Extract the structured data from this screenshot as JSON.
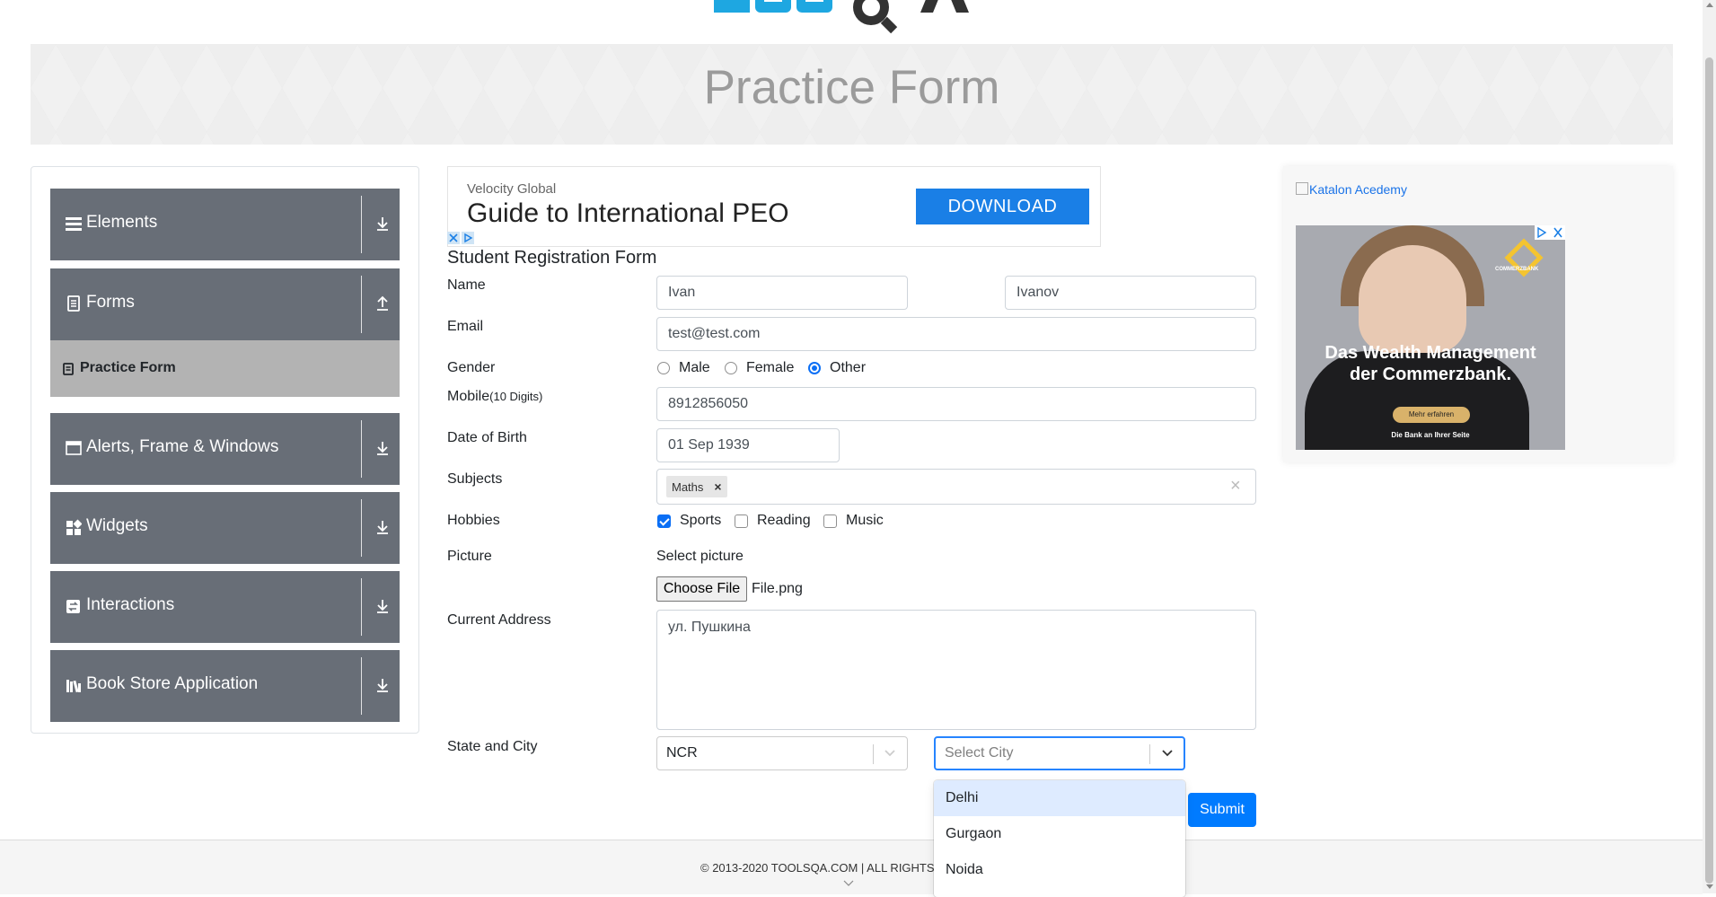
{
  "header": {
    "title": "Practice Form"
  },
  "sidebar": {
    "groups": [
      {
        "label": "Elements",
        "icon": "list-icon"
      },
      {
        "label": "Forms",
        "icon": "document-icon"
      },
      {
        "label": "Alerts, Frame & Windows",
        "icon": "window-icon"
      },
      {
        "label": "Widgets",
        "icon": "widgets-icon"
      },
      {
        "label": "Interactions",
        "icon": "interactions-icon"
      },
      {
        "label": "Book Store Application",
        "icon": "books-icon"
      }
    ],
    "active_item": {
      "label": "Practice Form",
      "icon": "form-icon"
    }
  },
  "ad_top": {
    "advertiser": "Velocity Global",
    "headline": "Guide to International PEO",
    "button": "DOWNLOAD"
  },
  "form": {
    "title": "Student Registration Form",
    "name_label": "Name",
    "first_name": "Ivan",
    "last_name": "Ivanov",
    "email_label": "Email",
    "email": "test@test.com",
    "gender_label": "Gender",
    "gender_options": [
      "Male",
      "Female",
      "Other"
    ],
    "gender_selected": "Other",
    "mobile_label": "Mobile",
    "mobile_hint": "(10 Digits)",
    "mobile": "8912856050",
    "dob_label": "Date of Birth",
    "dob": "01 Sep 1939",
    "subjects_label": "Subjects",
    "subjects": [
      "Maths"
    ],
    "subject_remove": "×",
    "subjects_clear": "×",
    "hobbies_label": "Hobbies",
    "hobbies": [
      {
        "label": "Sports",
        "checked": true
      },
      {
        "label": "Reading",
        "checked": false
      },
      {
        "label": "Music",
        "checked": false
      }
    ],
    "picture_label": "Picture",
    "select_picture": "Select picture",
    "choose_file": "Choose File",
    "file_name": "File.png",
    "address_label": "Current Address",
    "address": "ул. Пушкина",
    "state_city_label": "State and City",
    "state": "NCR",
    "city_placeholder": "Select City",
    "city_options": [
      "Delhi",
      "Gurgaon",
      "Noida"
    ],
    "city_highlighted": "Delhi",
    "submit": "Submit"
  },
  "ad_right": {
    "alt_text": "Katalon Acedemy",
    "headline": "Das Wealth Management der Commerzbank.",
    "button": "Mehr erfahren",
    "tagline": "Die Bank an Ihrer Seite",
    "brand": "COMMERZBANK"
  },
  "footer": {
    "text": "© 2013-2020 TOOLSQA.COM | ALL RIGHTS"
  },
  "colors": {
    "accent": "#007bff",
    "sidebar_group": "#686e77",
    "sidebar_active": "#b3b3b3",
    "logo_blue": "#1ea7e1"
  }
}
